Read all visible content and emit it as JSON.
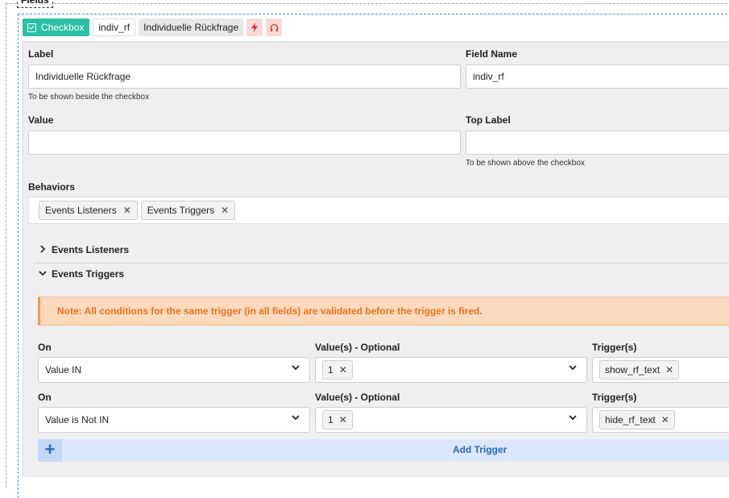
{
  "fieldset": {
    "legend": "Fields"
  },
  "header_tags": {
    "type_label": "Checkbox",
    "field_name": "indiv_rf",
    "label": "Individuelle Rückfrage",
    "trigger_icon": "bolt-icon",
    "listener_icon": "headphones-icon"
  },
  "form": {
    "label": {
      "title": "Label",
      "value": "Individuelle Rückfrage",
      "help": "To be shown beside the checkbox"
    },
    "field_name": {
      "title": "Field Name",
      "value": "indiv_rf"
    },
    "value": {
      "title": "Value",
      "value": ""
    },
    "top_label": {
      "title": "Top Label",
      "value": "",
      "help": "To be shown above the checkbox"
    },
    "behaviors": {
      "title": "Behaviors",
      "items": [
        "Events Listeners",
        "Events Triggers"
      ]
    }
  },
  "sections": {
    "listeners": {
      "title": "Events Listeners",
      "expanded": false
    },
    "triggers": {
      "title": "Events Triggers",
      "expanded": true
    }
  },
  "note": "Note: All conditions for the same trigger (in all fields) are validated before the trigger is fired.",
  "trigger_rows": [
    {
      "on_label": "On",
      "on_value": "Value IN",
      "values_label": "Value(s) - Optional",
      "values": [
        "1"
      ],
      "triggers_label": "Trigger(s)",
      "triggers": [
        "show_rf_text"
      ]
    },
    {
      "on_label": "On",
      "on_value": "Value is Not IN",
      "values_label": "Value(s) - Optional",
      "values": [
        "1"
      ],
      "triggers_label": "Trigger(s)",
      "triggers": [
        "hide_rf_text"
      ]
    }
  ],
  "add_trigger": {
    "label": "Add Trigger",
    "icon": "plus-icon"
  },
  "colors": {
    "accent": "#2bbfa4",
    "note_text": "#e9731d",
    "note_bg": "#fdd9bd",
    "add_bar": "#dbe8fb",
    "link_blue": "#2a66b8"
  }
}
